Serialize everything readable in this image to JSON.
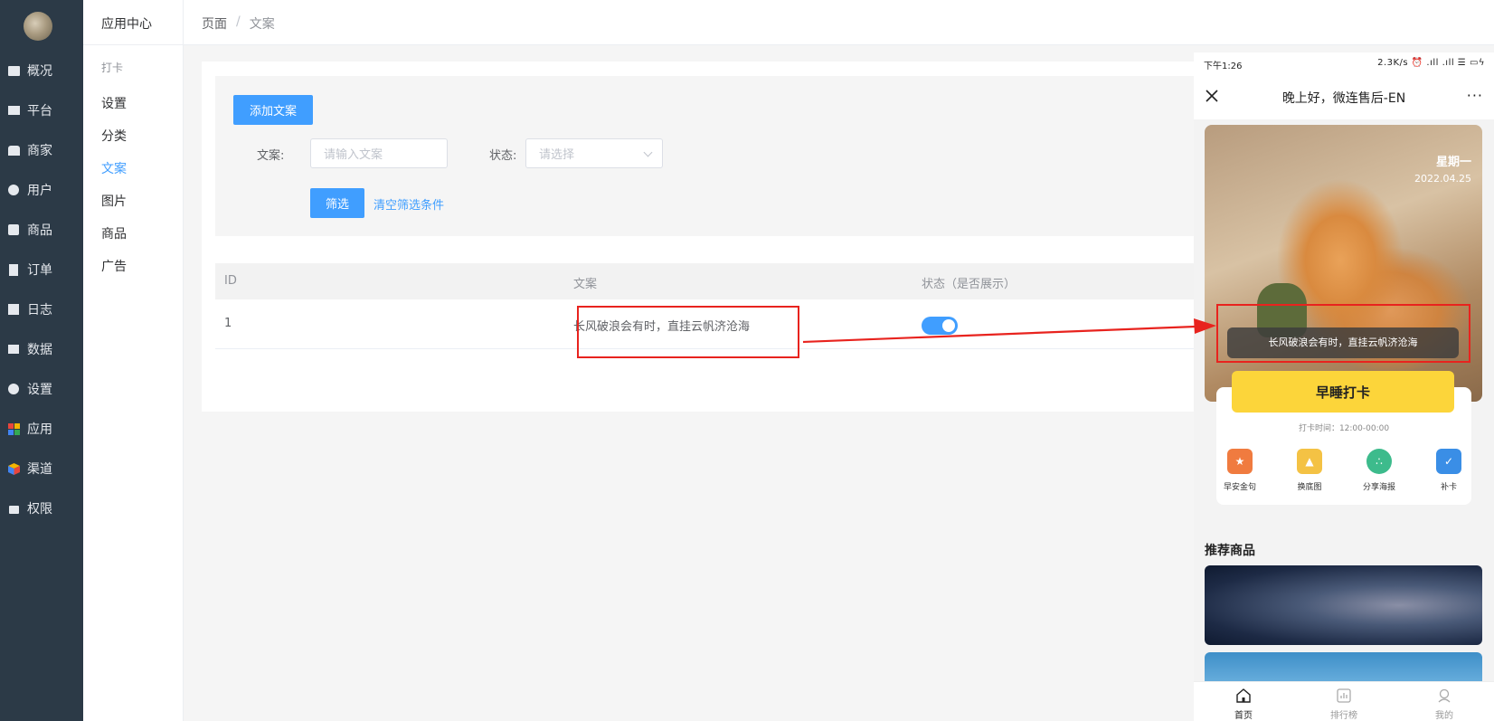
{
  "nav": {
    "items": [
      {
        "label": "概况",
        "icon": "dashboard-icon"
      },
      {
        "label": "平台",
        "icon": "monitor-icon"
      },
      {
        "label": "商家",
        "icon": "store-icon"
      },
      {
        "label": "用户",
        "icon": "user-icon"
      },
      {
        "label": "商品",
        "icon": "bag-icon"
      },
      {
        "label": "订单",
        "icon": "document-icon"
      },
      {
        "label": "日志",
        "icon": "book-icon"
      },
      {
        "label": "数据",
        "icon": "bar-chart-icon"
      },
      {
        "label": "设置",
        "icon": "gear-icon"
      },
      {
        "label": "应用",
        "icon": "apps-grid-icon"
      },
      {
        "label": "渠道",
        "icon": "cube-icon"
      },
      {
        "label": "权限",
        "icon": "lock-icon"
      }
    ]
  },
  "submenu": {
    "title": "应用中心",
    "group": "打卡",
    "items": [
      {
        "label": "设置",
        "active": false
      },
      {
        "label": "分类",
        "active": false
      },
      {
        "label": "文案",
        "active": true
      },
      {
        "label": "图片",
        "active": false
      },
      {
        "label": "商品",
        "active": false
      },
      {
        "label": "广告",
        "active": false
      }
    ]
  },
  "breadcrumb": {
    "root": "页面",
    "separator": "/",
    "current": "文案"
  },
  "toolbar": {
    "add_label": "添加文案"
  },
  "filter": {
    "text_label": "文案:",
    "text_placeholder": "请输入文案",
    "status_label": "状态:",
    "status_placeholder": "请选择",
    "filter_button": "筛选",
    "clear_link": "清空筛选条件"
  },
  "table": {
    "columns": [
      "ID",
      "文案",
      "状态（是否展示）"
    ],
    "rows": [
      {
        "id": "1",
        "text": "长风破浪会有时，直挂云帆济沧海",
        "status_on": true
      }
    ]
  },
  "phone": {
    "status_time": "下午1:26",
    "status_right": "2.3K/s ⏰ .ıll .ıll ☰ ▭ϟ",
    "title": "晚上好，微连售后-EN",
    "more": "···",
    "weekday": "星期一",
    "date": "2022.04.25",
    "quote": "长风破浪会有时，直挂云帆济沧海",
    "checkin_button": "早睡打卡",
    "checkin_time": "打卡时间：12:00-00:00",
    "quick_actions": [
      {
        "label": "早安金句",
        "icon": "star-book-icon",
        "color": "#f07b3f"
      },
      {
        "label": "换底图",
        "icon": "image-folder-icon",
        "color": "#f4c244"
      },
      {
        "label": "分享海报",
        "icon": "share-dots-icon",
        "color": "#3dbb8c"
      },
      {
        "label": "补卡",
        "icon": "clipboard-check-icon",
        "color": "#3a8ee6"
      }
    ],
    "recommend_title": "推荐商品",
    "tabs": [
      {
        "label": "首页",
        "icon": "home-icon",
        "active": true
      },
      {
        "label": "排行榜",
        "icon": "ranking-icon",
        "active": false
      },
      {
        "label": "我的",
        "icon": "profile-icon",
        "active": false
      }
    ]
  },
  "colors": {
    "nav_bg": "#2c3a47",
    "primary": "#409eff",
    "highlight": "#e8231e",
    "checkin_yellow": "#fcd53a"
  }
}
